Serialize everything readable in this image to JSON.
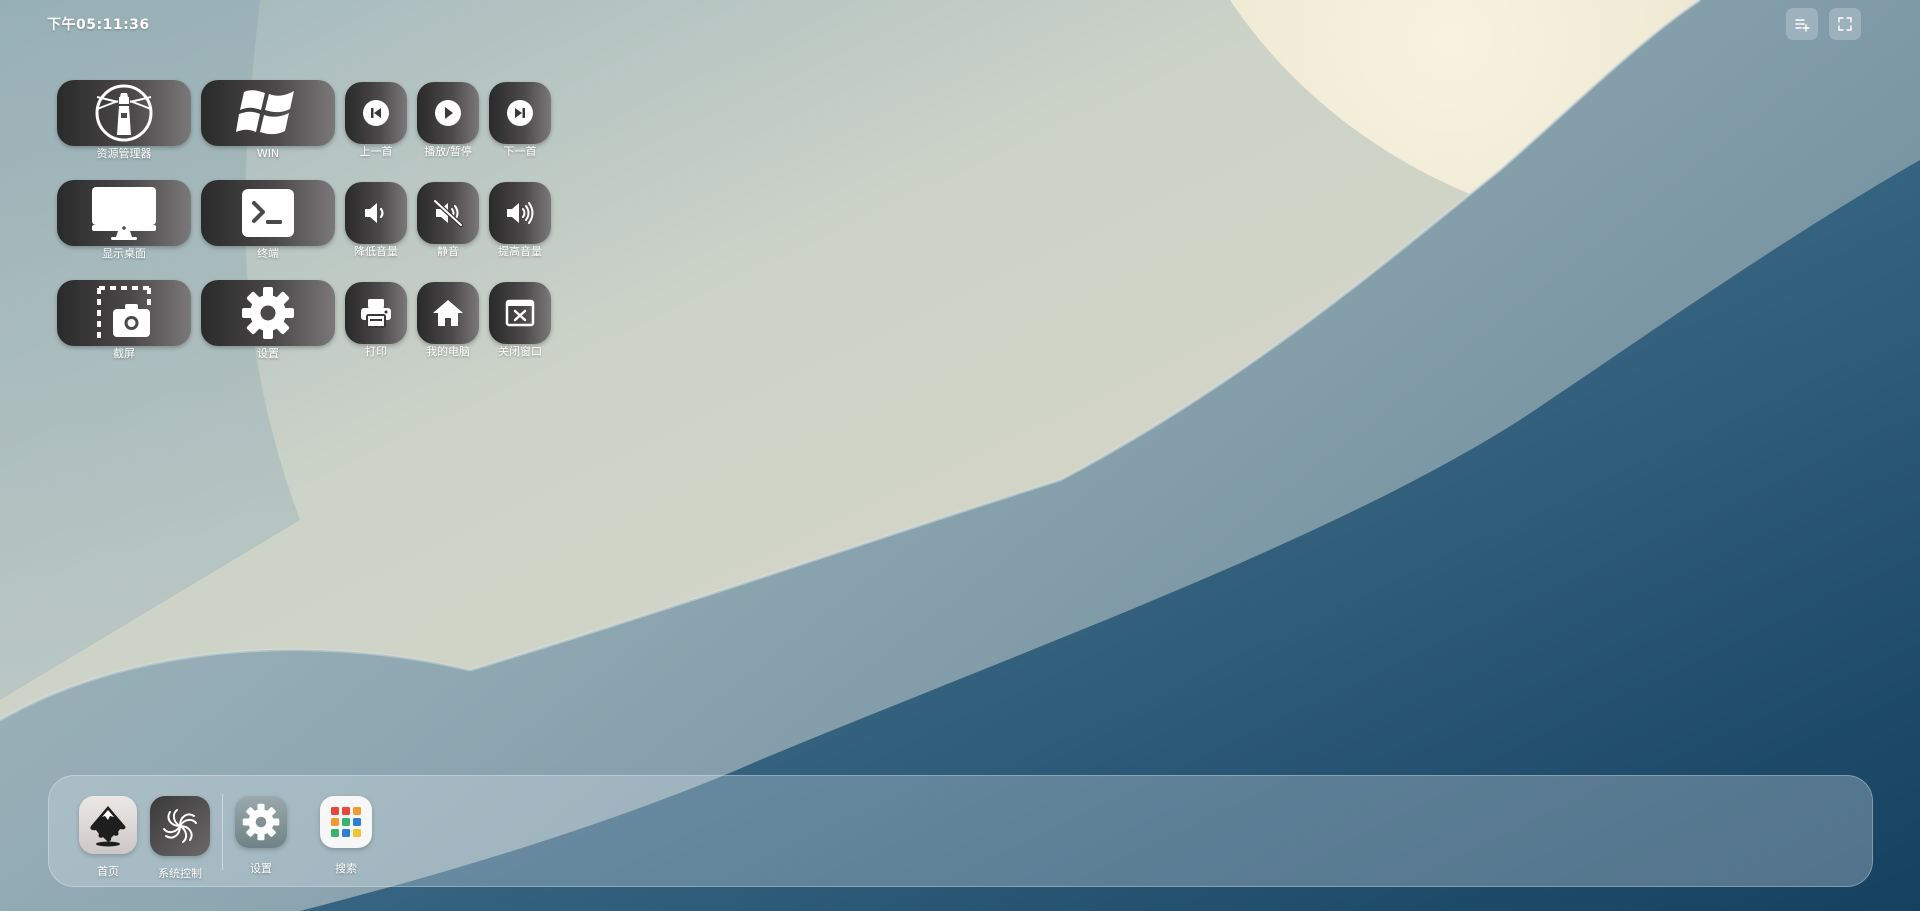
{
  "clock": {
    "time": "下午05:11:36"
  },
  "top_actions": [
    {
      "icon": "add-list-icon"
    },
    {
      "icon": "fullscreen-icon"
    }
  ],
  "grid": {
    "row1": [
      {
        "label": "资源管理器",
        "icon": "lighthouse-icon"
      },
      {
        "label": "WIN",
        "icon": "windows-logo-icon"
      },
      {
        "label": "上一首",
        "icon": "previous-track-icon"
      },
      {
        "label": "播放/暂停",
        "icon": "play-icon"
      },
      {
        "label": "下一首",
        "icon": "next-track-icon"
      }
    ],
    "row2": [
      {
        "label": "显示桌面",
        "icon": "monitor-icon"
      },
      {
        "label": "终端",
        "icon": "terminal-icon"
      },
      {
        "label": "降低音量",
        "icon": "volume-down-icon"
      },
      {
        "label": "静音",
        "icon": "mute-icon"
      },
      {
        "label": "提高音量",
        "icon": "volume-up-icon"
      }
    ],
    "row3": [
      {
        "label": "截屏",
        "icon": "screenshot-icon"
      },
      {
        "label": "设置",
        "icon": "gear-icon"
      },
      {
        "label": "打印",
        "icon": "printer-icon"
      },
      {
        "label": "我的电脑",
        "icon": "home-icon"
      },
      {
        "label": "关闭窗口",
        "icon": "close-window-icon"
      }
    ]
  },
  "dock": {
    "items": [
      {
        "label": "首页",
        "icon": "inkscape-icon"
      },
      {
        "label": "系统控制",
        "icon": "swirl-icon"
      },
      {
        "label": "设置",
        "icon": "gear-icon"
      },
      {
        "label": "搜索",
        "icon": "app-grid-icon"
      }
    ]
  },
  "colors": {
    "tile_dark": "#2b2a2b",
    "tile_light": "#7b7879",
    "text": "#ffffff",
    "grid_red": "#e8473c",
    "grid_orange": "#f29a2e",
    "grid_green": "#3bb36a",
    "grid_blue": "#2d7fd6",
    "grid_yellow": "#f2c230"
  }
}
